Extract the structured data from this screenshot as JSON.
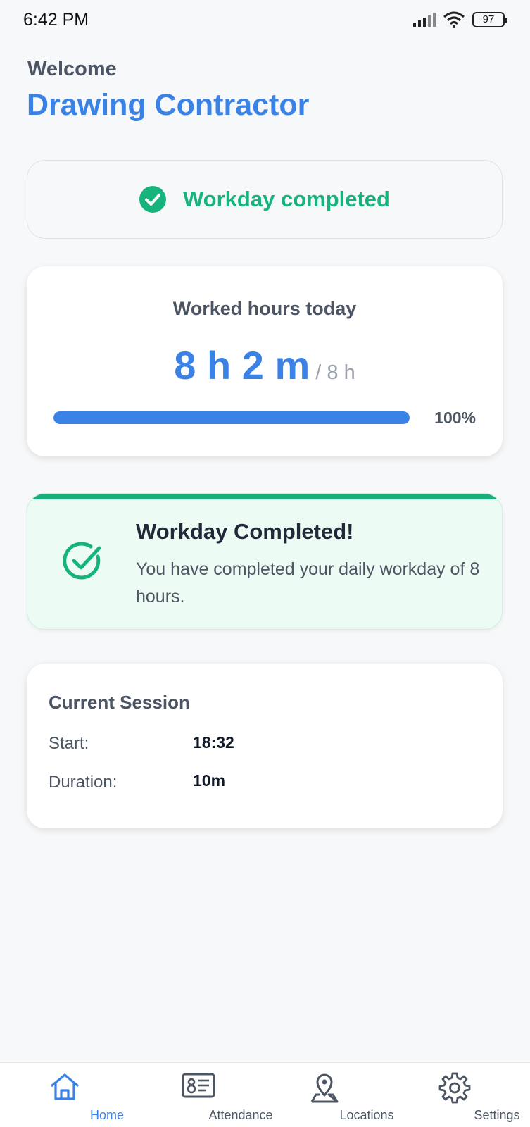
{
  "status_bar": {
    "time": "6:42 PM",
    "battery": "97",
    "icons": [
      "signal-icon",
      "wifi-icon",
      "battery-icon"
    ]
  },
  "header": {
    "welcome": "Welcome",
    "user_name": "Drawing Contractor"
  },
  "status": {
    "label": "Workday completed",
    "icon": "check-circle-icon"
  },
  "hours": {
    "title": "Worked hours today",
    "worked": "8 h 2 m",
    "target": "/ 8 h",
    "progress_label": "100%",
    "progress_fraction": 1.0
  },
  "completed_banner": {
    "title": "Workday Completed!",
    "message": "You have completed your daily workday of 8 hours.",
    "icon": "check-circle-outline-icon"
  },
  "session": {
    "title": "Current Session",
    "rows": [
      {
        "label": "Start:",
        "value": "18:32"
      },
      {
        "label": "Duration:",
        "value": "10m"
      }
    ]
  },
  "nav": {
    "items": [
      {
        "label": "Home",
        "icon": "home-icon",
        "active": true
      },
      {
        "label": "Attendance",
        "icon": "id-card-icon",
        "active": false
      },
      {
        "label": "Locations",
        "icon": "map-pin-icon",
        "active": false
      },
      {
        "label": "Settings",
        "icon": "gear-icon",
        "active": false
      }
    ]
  },
  "colors": {
    "accent": "#3b82e6",
    "success": "#16b47c",
    "success_bg": "#ecfbf3",
    "background": "#f7f8fa"
  }
}
